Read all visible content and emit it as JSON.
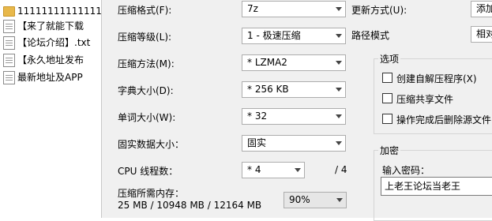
{
  "file_list": [
    {
      "name": "11111111111111",
      "icon": "folder-icon"
    },
    {
      "name": "【来了就能下载",
      "icon": "text-file-icon"
    },
    {
      "name": "【论坛介绍】.txt",
      "icon": "text-file-icon"
    },
    {
      "name": "【永久地址发布",
      "icon": "text-file-icon"
    },
    {
      "name": "最新地址及APP",
      "icon": "text-file-icon"
    }
  ],
  "left": {
    "format_label": "压缩格式(F):",
    "format_value": "7z",
    "level_label": "压缩等级(L):",
    "level_value": "1 - 极速压缩",
    "method_label": "压缩方法(M):",
    "method_value": "* LZMA2",
    "dict_label": "字典大小(D):",
    "dict_value": "* 256 KB",
    "word_label": "单词大小(W):",
    "word_value": "* 32",
    "solid_label": "固实数据大小：",
    "solid_value": "固实",
    "cpu_label": "CPU 线程数：",
    "cpu_value": "* 4",
    "cpu_total": "/ 4",
    "mem_label": "压缩所需内存：",
    "mem_value": "25 MB / 10948 MB / 12164 MB",
    "mem_percent": "90%"
  },
  "right": {
    "update_label": "更新方式(U):",
    "update_value": "添加",
    "path_label": "路径模式",
    "path_value": "相对",
    "options_title": "选项",
    "options": [
      {
        "label": "创建自解压程序(X)",
        "checked": false
      },
      {
        "label": "压缩共享文件",
        "checked": false
      },
      {
        "label": "操作完成后删除源文件",
        "checked": false
      }
    ],
    "encrypt_title": "加密",
    "password_label": "输入密码：",
    "password_value": "上老王论坛当老王"
  }
}
